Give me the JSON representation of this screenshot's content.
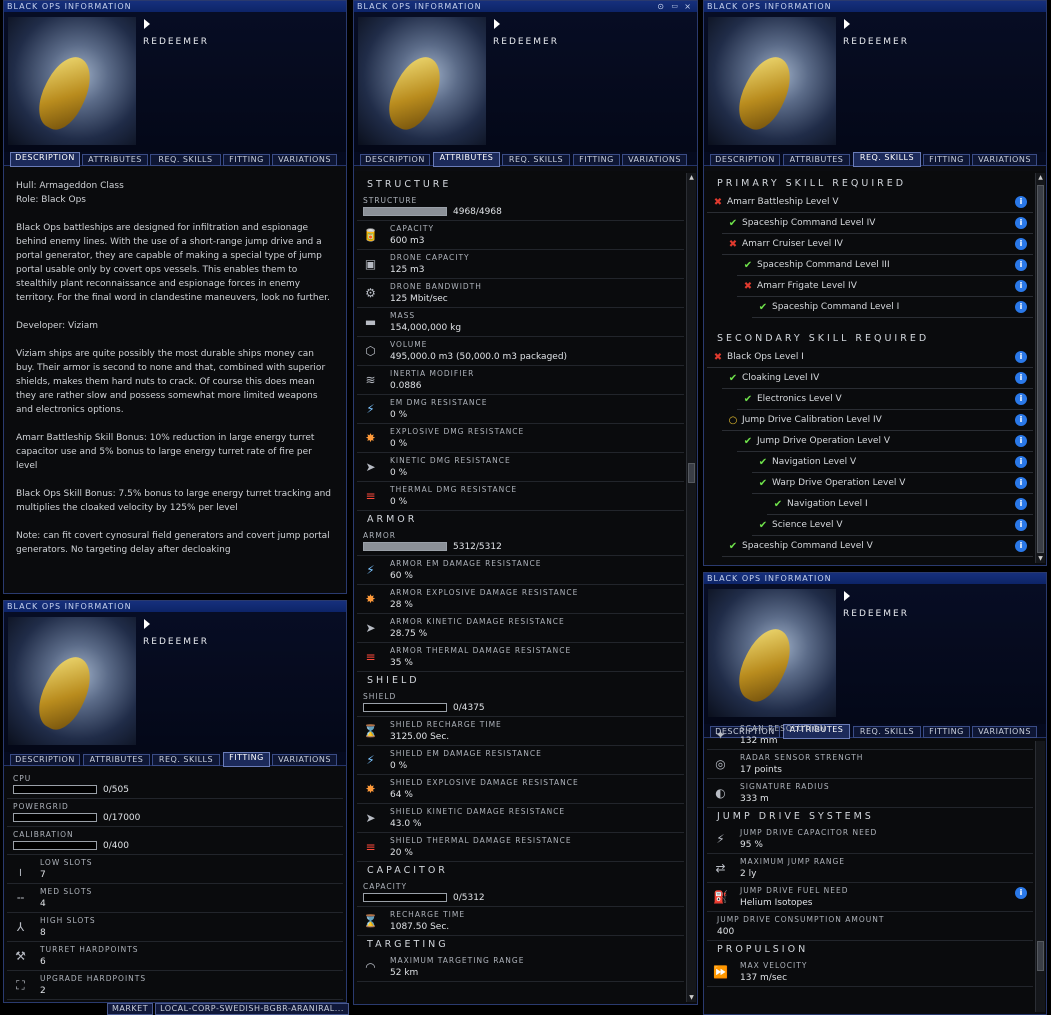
{
  "window_title": "BLACK OPS INFORMATION",
  "ship_name": "REDEEMER",
  "tabs": [
    "DESCRIPTION",
    "ATTRIBUTES",
    "REQ. SKILLS",
    "FITTING",
    "VARIATIONS"
  ],
  "window_buttons": {
    "minimize": "⊙",
    "close": "×"
  },
  "description": [
    "Hull: Armageddon Class\nRole: Black Ops",
    "Black Ops battleships are designed for infiltration and espionage behind enemy lines. With the use of a short-range jump drive and a portal generator, they are capable of making a special type of jump portal usable only by covert ops vessels. This enables them to stealthily plant reconnaissance and espionage forces in enemy territory. For the final word in clandestine maneuvers, look no further.",
    "Developer: Viziam",
    "Viziam ships are quite possibly the most durable ships money can buy. Their armor is second to none and that, combined with superior shields, makes them hard nuts to crack. Of course this does mean they are rather slow and possess somewhat more limited weapons and electronics options.",
    "Amarr Battleship Skill Bonus: 10% reduction in large energy turret capacitor use and 5% bonus to large energy turret rate of fire per level",
    "Black Ops Skill Bonus: 7.5% bonus to large energy turret tracking and multiplies the cloaked velocity by 125% per level",
    "Note: can fit covert cynosural field generators and covert jump portal generators. No targeting delay after decloaking"
  ],
  "attributes": [
    {
      "section": "STRUCTURE",
      "items": [
        {
          "bar": true,
          "label": "STRUCTURE",
          "value": "4968/4968",
          "fill": 1.0
        },
        {
          "icon": "cargo-icon",
          "cls": "i-grey",
          "glyph": "🥫",
          "label": "CAPACITY",
          "value": "600 m3"
        },
        {
          "icon": "drone-bay-icon",
          "cls": "i-grey",
          "glyph": "▣",
          "label": "DRONE CAPACITY",
          "value": "125 m3"
        },
        {
          "icon": "drone-bandwidth-icon",
          "cls": "i-grey",
          "glyph": "⚙",
          "label": "DRONE BANDWIDTH",
          "value": "125 Mbit/sec"
        },
        {
          "icon": "mass-icon",
          "cls": "i-grey",
          "glyph": "▬",
          "label": "MASS",
          "value": "154,000,000 kg"
        },
        {
          "icon": "volume-icon",
          "cls": "i-grey",
          "glyph": "⬡",
          "label": "VOLUME",
          "value": "495,000.0 m3 (50,000.0 m3 packaged)"
        },
        {
          "icon": "inertia-icon",
          "cls": "i-grey",
          "glyph": "≋",
          "label": "INERTIA MODIFIER",
          "value": "0.0886"
        },
        {
          "icon": "em-resist-icon",
          "cls": "i-blue",
          "glyph": "⚡",
          "label": "EM DMG RESISTANCE",
          "value": "0 %"
        },
        {
          "icon": "explosive-resist-icon",
          "cls": "i-orange",
          "glyph": "✸",
          "label": "EXPLOSIVE DMG RESISTANCE",
          "value": "0 %"
        },
        {
          "icon": "kinetic-resist-icon",
          "cls": "i-grey",
          "glyph": "➤",
          "label": "KINETIC DMG RESISTANCE",
          "value": "0 %"
        },
        {
          "icon": "thermal-resist-icon",
          "cls": "i-red",
          "glyph": "≡",
          "label": "THERMAL DMG RESISTANCE",
          "value": "0 %"
        }
      ]
    },
    {
      "section": "ARMOR",
      "items": [
        {
          "bar": true,
          "label": "ARMOR",
          "value": "5312/5312",
          "fill": 1.0
        },
        {
          "icon": "em-resist-icon",
          "cls": "i-blue",
          "glyph": "⚡",
          "label": "ARMOR EM DAMAGE RESISTANCE",
          "value": "60 %"
        },
        {
          "icon": "explosive-resist-icon",
          "cls": "i-orange",
          "glyph": "✸",
          "label": "ARMOR EXPLOSIVE DAMAGE RESISTANCE",
          "value": "28 %"
        },
        {
          "icon": "kinetic-resist-icon",
          "cls": "i-grey",
          "glyph": "➤",
          "label": "ARMOR KINETIC DAMAGE RESISTANCE",
          "value": "28.75 %"
        },
        {
          "icon": "thermal-resist-icon",
          "cls": "i-red",
          "glyph": "≡",
          "label": "ARMOR THERMAL DAMAGE RESISTANCE",
          "value": "35 %"
        }
      ]
    },
    {
      "section": "SHIELD",
      "items": [
        {
          "bar": true,
          "label": "SHIELD",
          "value": "0/4375",
          "fill": 0
        },
        {
          "icon": "hourglass-icon",
          "cls": "i-grey",
          "glyph": "⌛",
          "label": "SHIELD RECHARGE TIME",
          "value": "3125.00 Sec."
        },
        {
          "icon": "em-resist-icon",
          "cls": "i-blue",
          "glyph": "⚡",
          "label": "SHIELD EM DAMAGE RESISTANCE",
          "value": "0 %"
        },
        {
          "icon": "explosive-resist-icon",
          "cls": "i-orange",
          "glyph": "✸",
          "label": "SHIELD EXPLOSIVE DAMAGE RESISTANCE",
          "value": "64 %"
        },
        {
          "icon": "kinetic-resist-icon",
          "cls": "i-grey",
          "glyph": "➤",
          "label": "SHIELD KINETIC DAMAGE RESISTANCE",
          "value": "43.0 %"
        },
        {
          "icon": "thermal-resist-icon",
          "cls": "i-red",
          "glyph": "≡",
          "label": "SHIELD THERMAL DAMAGE RESISTANCE",
          "value": "20 %"
        }
      ]
    },
    {
      "section": "CAPACITOR",
      "items": [
        {
          "bar": true,
          "label": "CAPACITY",
          "value": "0/5312",
          "fill": 0
        },
        {
          "icon": "hourglass-icon",
          "cls": "i-grey",
          "glyph": "⌛",
          "label": "RECHARGE TIME",
          "value": "1087.50 Sec."
        }
      ]
    },
    {
      "section": "TARGETING",
      "items": [
        {
          "icon": "targeting-range-icon",
          "cls": "i-grey",
          "glyph": "◠",
          "label": "MAXIMUM TARGETING RANGE",
          "value": "52 km"
        }
      ]
    }
  ],
  "skills": {
    "primary_title": "PRIMARY SKILL REQUIRED",
    "primary": [
      {
        "status": "missing",
        "level": 0,
        "name": "Amarr Battleship Level V"
      },
      {
        "status": "ok",
        "level": 1,
        "name": "Spaceship Command Level IV"
      },
      {
        "status": "missing",
        "level": 1,
        "name": "Amarr Cruiser Level IV"
      },
      {
        "status": "ok",
        "level": 2,
        "name": "Spaceship Command Level III"
      },
      {
        "status": "missing",
        "level": 2,
        "name": "Amarr Frigate Level IV"
      },
      {
        "status": "ok",
        "level": 3,
        "name": "Spaceship Command Level I"
      }
    ],
    "secondary_title": "SECONDARY SKILL REQUIRED",
    "secondary": [
      {
        "status": "missing",
        "level": 0,
        "name": "Black Ops Level I"
      },
      {
        "status": "ok",
        "level": 1,
        "name": "Cloaking Level IV"
      },
      {
        "status": "ok",
        "level": 2,
        "name": "Electronics Level V"
      },
      {
        "status": "partial",
        "level": 1,
        "name": "Jump Drive Calibration Level IV"
      },
      {
        "status": "ok",
        "level": 2,
        "name": "Jump Drive Operation Level V"
      },
      {
        "status": "ok",
        "level": 3,
        "name": "Navigation Level V"
      },
      {
        "status": "ok",
        "level": 3,
        "name": "Warp Drive Operation Level V"
      },
      {
        "status": "ok",
        "level": 4,
        "name": "Navigation Level I"
      },
      {
        "status": "ok",
        "level": 3,
        "name": "Science Level V"
      },
      {
        "status": "ok",
        "level": 1,
        "name": "Spaceship Command Level V"
      }
    ]
  },
  "fitting": [
    {
      "bar": true,
      "label": "CPU",
      "value": "0/505",
      "fill": 0
    },
    {
      "bar": true,
      "label": "POWERGRID",
      "value": "0/17000",
      "fill": 0
    },
    {
      "bar": true,
      "label": "CALIBRATION",
      "value": "0/400",
      "fill": 0
    },
    {
      "icon": "low-slot-icon",
      "cls": "i-grey",
      "glyph": "╷",
      "label": "LOW SLOTS",
      "value": "7"
    },
    {
      "icon": "med-slot-icon",
      "cls": "i-grey",
      "glyph": "╌",
      "label": "MED SLOTS",
      "value": "4"
    },
    {
      "icon": "high-slot-icon",
      "cls": "i-grey",
      "glyph": "⅄",
      "label": "HIGH SLOTS",
      "value": "8"
    },
    {
      "icon": "turret-icon",
      "cls": "i-grey",
      "glyph": "⚒",
      "label": "TURRET HARDPOINTS",
      "value": "6"
    },
    {
      "icon": "upgrade-icon",
      "cls": "i-grey",
      "glyph": "⛶",
      "label": "UPGRADE HARDPOINTS",
      "value": "2"
    }
  ],
  "attributes2": [
    {
      "partial": true,
      "icon": "scan-resolution-icon",
      "cls": "i-grey",
      "glyph": "✦",
      "label": "SCAN RESOLUTION",
      "value": "132 mm"
    },
    {
      "icon": "radar-icon",
      "cls": "i-grey",
      "glyph": "◎",
      "label": "RADAR SENSOR STRENGTH",
      "value": "17 points"
    },
    {
      "icon": "signature-icon",
      "cls": "i-grey",
      "glyph": "◐",
      "label": "SIGNATURE RADIUS",
      "value": "333 m"
    },
    {
      "section": "JUMP DRIVE SYSTEMS"
    },
    {
      "icon": "jump-capacitor-icon",
      "cls": "i-grey",
      "glyph": "⚡",
      "label": "JUMP DRIVE CAPACITOR NEED",
      "value": "95 %"
    },
    {
      "icon": "jump-range-icon",
      "cls": "i-grey",
      "glyph": "⇄",
      "label": "MAXIMUM JUMP RANGE",
      "value": "2 ly"
    },
    {
      "icon": "fuel-icon",
      "cls": "i-grey",
      "glyph": "⛽",
      "label": "JUMP DRIVE FUEL NEED",
      "value": "Helium Isotopes",
      "info": true
    },
    {
      "noicon": true,
      "label": "JUMP DRIVE CONSUMPTION AMOUNT",
      "value": "400"
    },
    {
      "section": "PROPULSION"
    },
    {
      "icon": "velocity-icon",
      "cls": "i-grey",
      "glyph": "⏩",
      "label": "MAX VELOCITY",
      "value": "137 m/sec"
    }
  ],
  "taskbar": [
    "MARKET",
    "LOCAL-CORP-SWEDISH-BGBR-ARANIRAL..."
  ]
}
